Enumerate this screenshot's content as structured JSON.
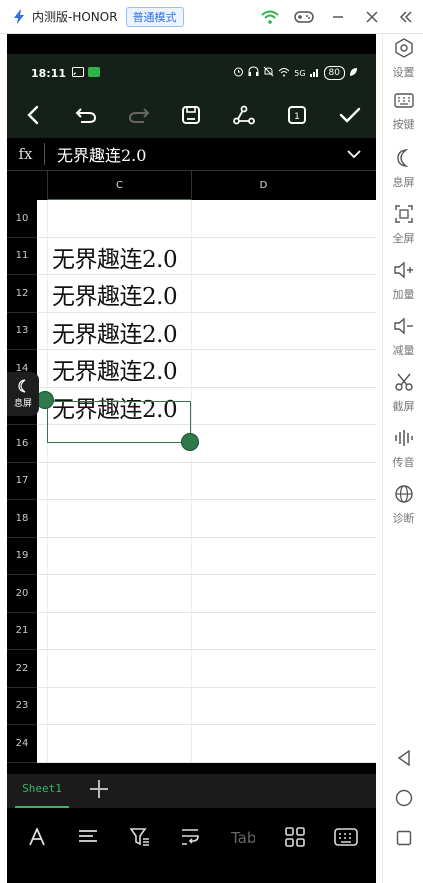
{
  "host": {
    "title": "内测版-HONOR",
    "mode": "普通模式"
  },
  "status": {
    "time": "18:11",
    "battery": "80",
    "network": "5G"
  },
  "formula": {
    "fx": "fx",
    "value": "无界趣连2.0"
  },
  "columns": [
    "C",
    "D"
  ],
  "rows": [
    {
      "num": "10",
      "text": ""
    },
    {
      "num": "11",
      "text": "无界趣连2.0"
    },
    {
      "num": "12",
      "text": "无界趣连2.0"
    },
    {
      "num": "13",
      "text": "无界趣连2.0"
    },
    {
      "num": "14",
      "text": "无界趣连2.0"
    },
    {
      "num": "15",
      "text": "无界趣连2.0"
    },
    {
      "num": "16",
      "text": ""
    },
    {
      "num": "17",
      "text": ""
    },
    {
      "num": "18",
      "text": ""
    },
    {
      "num": "19",
      "text": ""
    },
    {
      "num": "20",
      "text": ""
    },
    {
      "num": "21",
      "text": ""
    },
    {
      "num": "22",
      "text": ""
    },
    {
      "num": "23",
      "text": ""
    },
    {
      "num": "24",
      "text": ""
    }
  ],
  "float_button": {
    "label": "息屏"
  },
  "sheet": {
    "tab": "Sheet1"
  },
  "side_panel": {
    "items": [
      {
        "icon": "settings-icon",
        "label": "设置"
      },
      {
        "icon": "keyboard-icon",
        "label": "按键"
      },
      {
        "icon": "moon-icon",
        "label": "息屏"
      },
      {
        "icon": "fullscreen-icon",
        "label": "全屏"
      },
      {
        "icon": "volume-up-icon",
        "label": "加量"
      },
      {
        "icon": "volume-down-icon",
        "label": "减量"
      },
      {
        "icon": "scissors-icon",
        "label": "截屏"
      },
      {
        "icon": "audio-wave-icon",
        "label": "传音"
      },
      {
        "icon": "globe-icon",
        "label": "诊断"
      }
    ]
  },
  "colors": {
    "accent": "#2e7a4b",
    "toolbar_bg": "#142018",
    "host_accent": "#2f6fe4"
  }
}
